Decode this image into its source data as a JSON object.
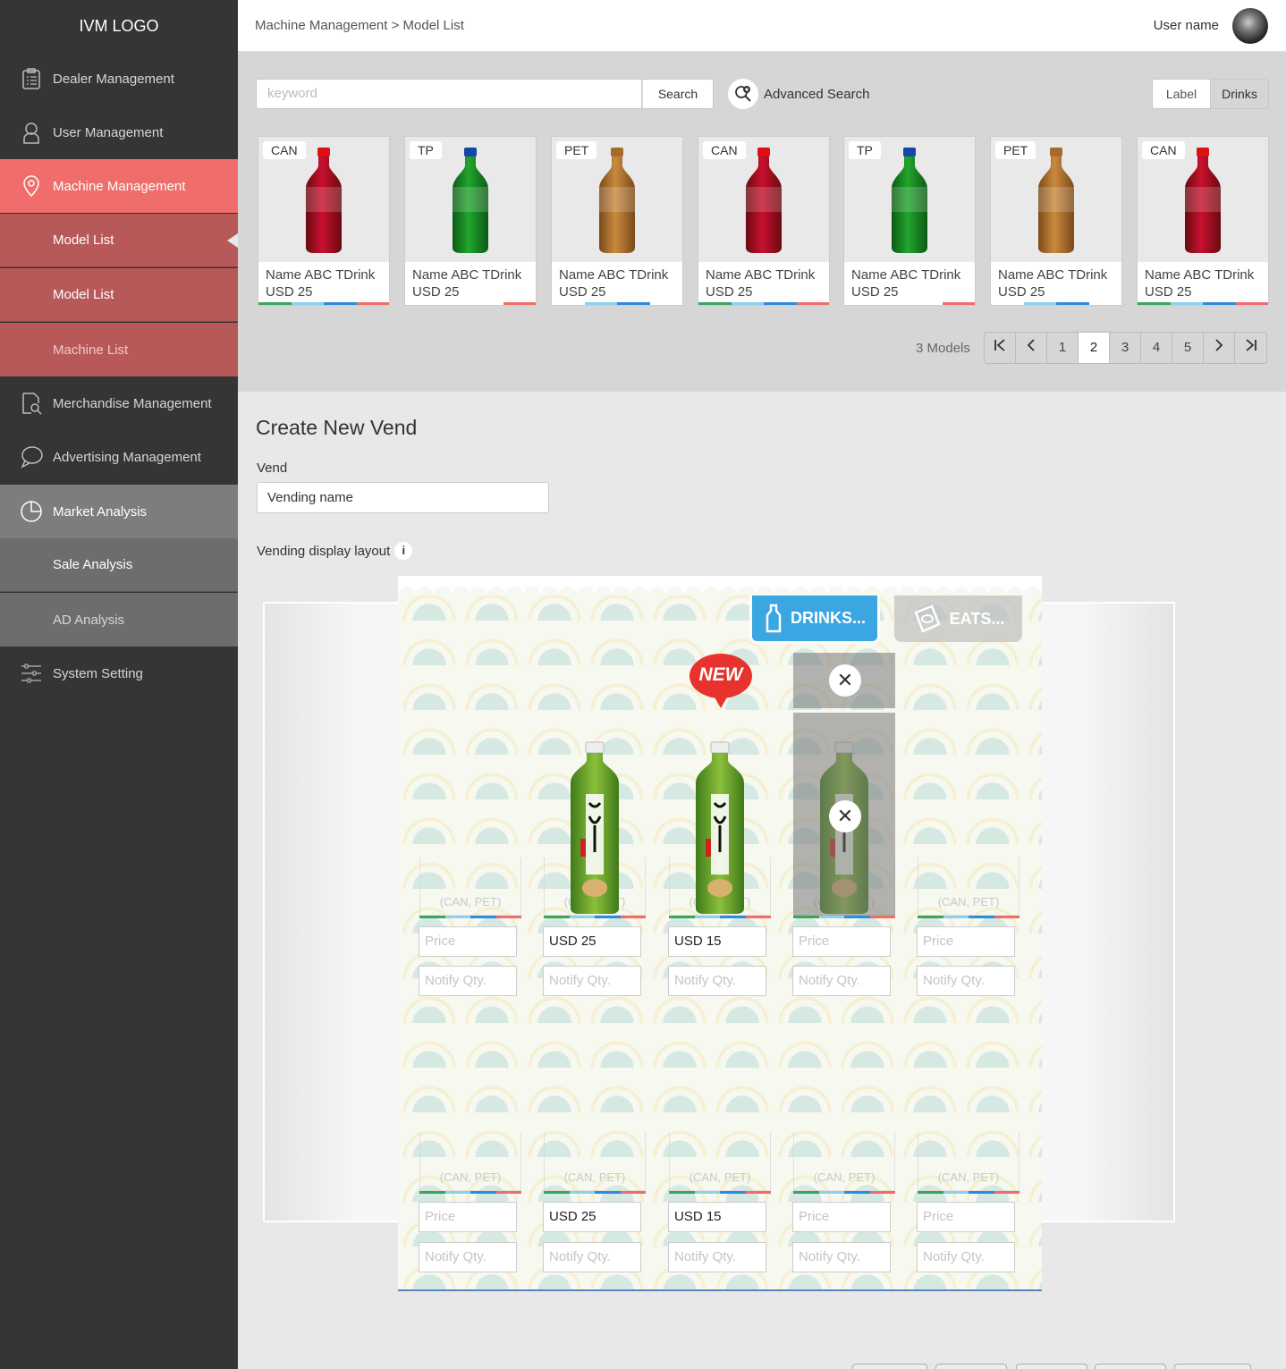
{
  "app": {
    "logo": "IVM LOGO"
  },
  "sidebar": {
    "items": [
      {
        "label": "Dealer Management",
        "icon": "clipboard-icon"
      },
      {
        "label": "User Management",
        "icon": "user-icon"
      },
      {
        "label": "Machine Management",
        "icon": "location-pin-icon"
      },
      {
        "label": "Model List"
      },
      {
        "label": "Model List"
      },
      {
        "label": "Machine List"
      },
      {
        "label": "Merchandise Management",
        "icon": "document-search-icon"
      },
      {
        "label": "Advertising Management",
        "icon": "speech-bubble-icon"
      },
      {
        "label": "Market Analysis",
        "icon": "pie-chart-icon"
      },
      {
        "label": "Sale Analysis"
      },
      {
        "label": "AD Analysis"
      },
      {
        "label": "System Setting",
        "icon": "sliders-icon"
      }
    ]
  },
  "header": {
    "breadcrumb": "Machine Management > Model List",
    "user_name": "User name"
  },
  "search": {
    "placeholder": "keyword",
    "button": "Search",
    "advanced": "Advanced Search"
  },
  "view_toggle": {
    "label": "Label",
    "drinks": "Drinks",
    "selected": "Drinks"
  },
  "products": [
    {
      "tag": "CAN",
      "name": "Name ABC TDrink",
      "price": "USD 25",
      "bottle": "red"
    },
    {
      "tag": "TP",
      "name": "Name ABC TDrink",
      "price": "USD 25",
      "bottle": "green"
    },
    {
      "tag": "PET",
      "name": "Name ABC TDrink",
      "price": "USD 25",
      "bottle": "brown"
    },
    {
      "tag": "CAN",
      "name": "Name ABC TDrink",
      "price": "USD 25",
      "bottle": "red"
    },
    {
      "tag": "TP",
      "name": "Name ABC TDrink",
      "price": "USD 25",
      "bottle": "green"
    },
    {
      "tag": "PET",
      "name": "Name ABC TDrink",
      "price": "USD 25",
      "bottle": "brown"
    },
    {
      "tag": "CAN",
      "name": "Name ABC TDrink",
      "price": "USD 25",
      "bottle": "red"
    }
  ],
  "pagination": {
    "count_label": "3 Models",
    "pages": [
      "1",
      "2",
      "3",
      "4",
      "5"
    ],
    "current": "2"
  },
  "create": {
    "title": "Create New Vend",
    "vend_label": "Vend",
    "vend_value": "Vending name",
    "layout_label": "Vending display layout",
    "info": "i"
  },
  "screen": {
    "tab_drinks": "DRINKS...",
    "tab_eats": "EATS...",
    "new_badge": "NEW",
    "close": "✕",
    "slot_caption": "(CAN, PET)",
    "price_placeholder": "Price",
    "notify_placeholder": "Notify Qty.",
    "row1": [
      {
        "price": "",
        "has_product": false
      },
      {
        "price": "USD 25",
        "has_product": true
      },
      {
        "price": "USD 15",
        "has_product": true,
        "new": true
      },
      {
        "price": "",
        "has_product": true,
        "selected": true
      },
      {
        "price": "",
        "has_product": false
      }
    ],
    "row2": [
      {
        "price": ""
      },
      {
        "price": "USD 25"
      },
      {
        "price": "USD 15"
      },
      {
        "price": ""
      },
      {
        "price": ""
      }
    ]
  },
  "colors": {
    "accent": "#ef6d6a",
    "submenu": "#b85959",
    "sidebar": "#353535",
    "drinks_tab": "#3aa6e2",
    "bar": [
      "#3aa65a",
      "#8fd0ef",
      "#2a8de0",
      "#ef6d6a"
    ]
  }
}
